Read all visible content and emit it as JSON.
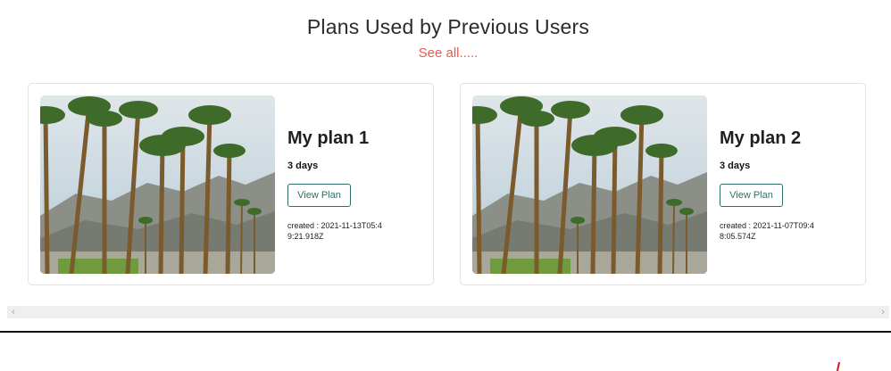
{
  "section": {
    "title": "Plans Used by Previous Users",
    "see_all": "See all....."
  },
  "cards": [
    {
      "name": "My plan 1",
      "duration": "3 days",
      "button_label": "View Plan",
      "created": "created : 2021-11-13T05:49:21.918Z"
    },
    {
      "name": "My plan 2",
      "duration": "3 days",
      "button_label": "View Plan",
      "created": "created : 2021-11-07T09:48:05.574Z"
    }
  ],
  "scrollbar": {
    "left_icon": "chevron-left-icon",
    "right_icon": "chevron-right-icon"
  },
  "colors": {
    "accent": "#e85a4f",
    "button_border": "#2f6f6a",
    "card_border": "#dfe3e6"
  }
}
